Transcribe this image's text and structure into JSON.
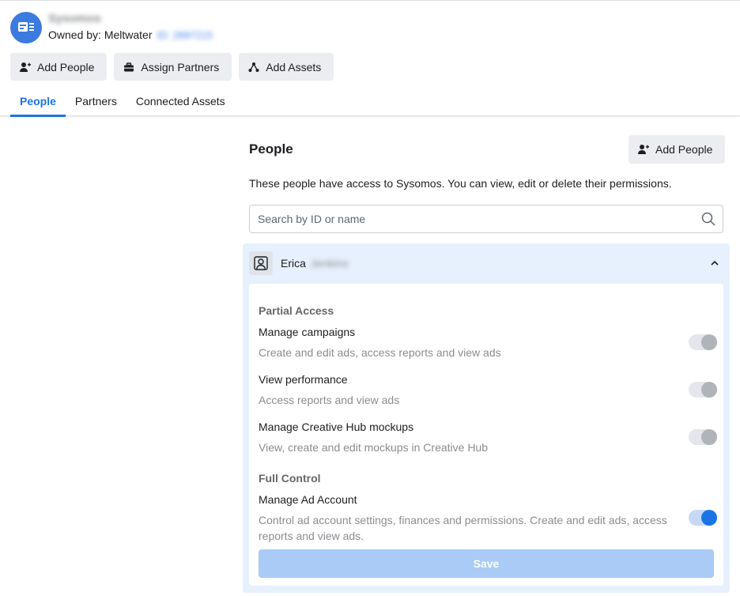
{
  "account": {
    "name": "Sysomos",
    "owned_label": "Owned by: Meltwater",
    "owned_id": "ID: 2897215",
    "icon": "business-account-icon",
    "accent": "#3b7be0"
  },
  "actions": {
    "add_people": "Add People",
    "assign_partners": "Assign Partners",
    "add_assets": "Add Assets"
  },
  "tabs": [
    {
      "label": "People",
      "active": true
    },
    {
      "label": "Partners",
      "active": false
    },
    {
      "label": "Connected Assets",
      "active": false
    }
  ],
  "people_section": {
    "title": "People",
    "add_button": "Add People",
    "description": "These people have access to Sysomos. You can view, edit or delete their permissions.",
    "search_placeholder": "Search by ID or name"
  },
  "person": {
    "first_name": "Erica",
    "last_name": "Jenkins",
    "groups": [
      {
        "label": "Partial Access",
        "permissions": [
          {
            "title": "Manage campaigns",
            "subtitle": "Create and edit ads, access reports and view ads",
            "enabled": false
          },
          {
            "title": "View performance",
            "subtitle": "Access reports and view ads",
            "enabled": false
          },
          {
            "title": "Manage Creative Hub mockups",
            "subtitle": "View, create and edit mockups in Creative Hub",
            "enabled": false
          }
        ]
      },
      {
        "label": "Full Control",
        "permissions": [
          {
            "title": "Manage Ad Account",
            "subtitle": "Control ad account settings, finances and permissions. Create and edit ads, access reports and view ads.",
            "enabled": true
          }
        ]
      }
    ],
    "save_label": "Save"
  },
  "colors": {
    "primary": "#1b74e4",
    "card_bg": "#e7f0fd",
    "save_disabled": "#a9cbf6"
  }
}
